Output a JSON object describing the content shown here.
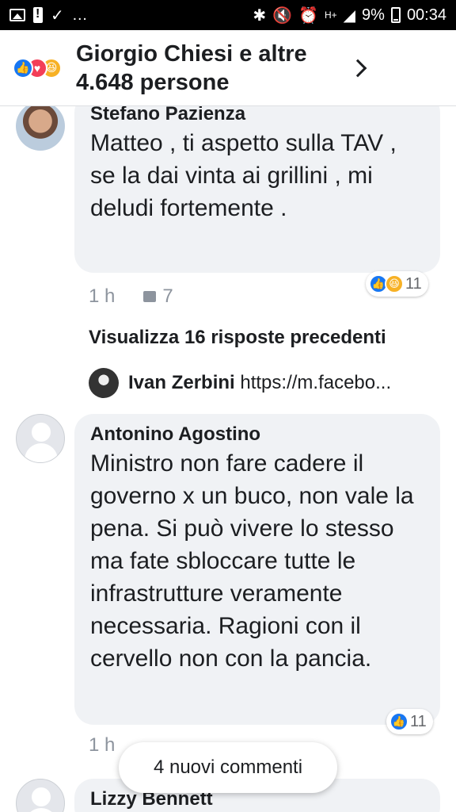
{
  "status_bar": {
    "signal_text": "H+",
    "battery": "9%",
    "time": "00:34"
  },
  "header": {
    "title": "Giorgio Chiesi e altre 4.648 persone"
  },
  "comments": [
    {
      "author": "Stefano Pazienza",
      "text": "Matteo , ti aspetto sulla TAV , se la dai vinta ai grillini , mi deludi fortemente .",
      "reactions_count": "11",
      "time": "1 h",
      "likes": "7"
    },
    {
      "author": "Antonino Agostino",
      "text": "Ministro non fare cadere il governo x un buco, non vale la pena. Si può vivere lo stesso ma fate sbloccare tutte le infrastrutture veramente necessaria. Ragioni con il cervello non con la pancia.",
      "reactions_count": "11",
      "time": "1 h"
    }
  ],
  "replies": {
    "view_previous": "Visualizza 16 risposte precedenti",
    "preview_author": "Ivan Zerbini",
    "preview_text": "https://m.facebo..."
  },
  "partial_next_author": "Lizzy Bennett",
  "new_comments_label": "4 nuovi commenti"
}
